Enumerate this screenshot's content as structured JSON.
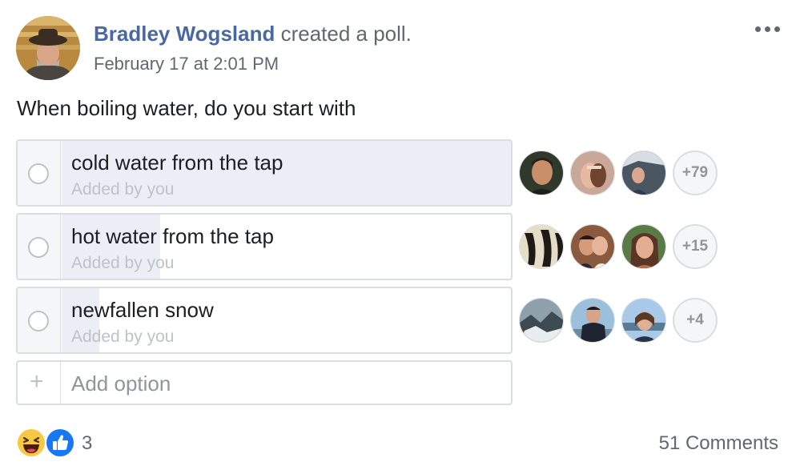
{
  "post": {
    "author": "Bradley Wogsland",
    "action": " created a poll.",
    "timestamp": "February 17 at 2:01 PM",
    "question": "When boiling water, do you start with"
  },
  "poll": {
    "options": [
      {
        "label": "cold water from the tap",
        "added_by": "Added by you",
        "vote_share": 1.0,
        "more_voters": "+79"
      },
      {
        "label": "hot water from the tap",
        "added_by": "Added by you",
        "vote_share": 0.22,
        "more_voters": "+15"
      },
      {
        "label": "newfallen snow",
        "added_by": "Added by you",
        "vote_share": 0.084,
        "more_voters": "+4"
      }
    ],
    "add_option": "Add option",
    "highlight_color": "#ebeef5"
  },
  "footer": {
    "reaction_count": "3",
    "comments": "51 Comments",
    "reactions": [
      "haha-icon",
      "like-icon"
    ]
  },
  "colors": {
    "author_link": "#4b67a1",
    "secondary_text": "#616770",
    "border": "#dadde1"
  }
}
